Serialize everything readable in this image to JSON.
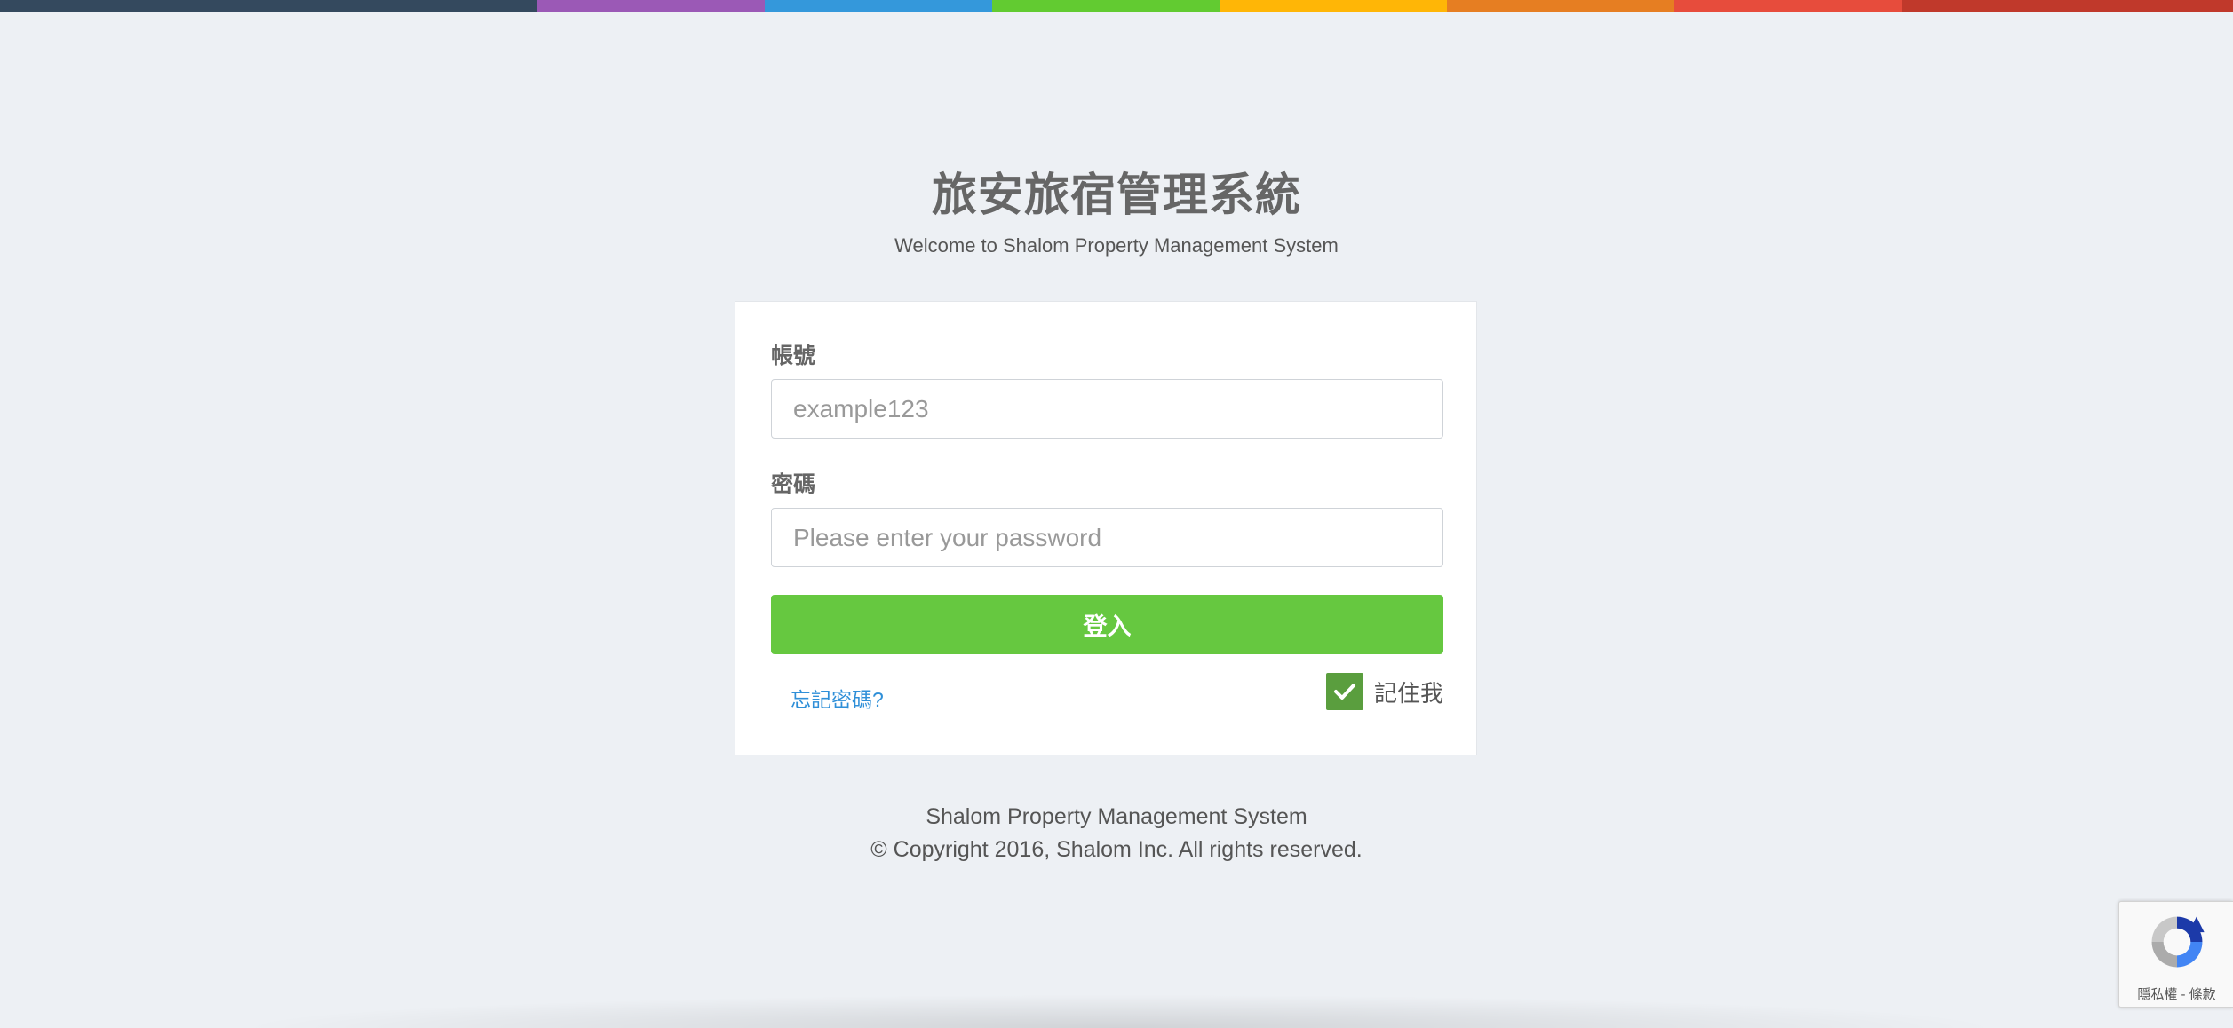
{
  "top_bar": {
    "colors": [
      "#34495e",
      "#9b59b6",
      "#3498db",
      "#62cb31",
      "#ffb606",
      "#e67e22",
      "#e74c3c",
      "#c0392b"
    ]
  },
  "header": {
    "title": "旅安旅宿管理系統",
    "subtitle": "Welcome to Shalom Property Management System"
  },
  "login_form": {
    "account_label": "帳號",
    "account_placeholder": "example123",
    "account_value": "",
    "password_label": "密碼",
    "password_placeholder": "Please enter your password",
    "password_value": "",
    "login_button_label": "登入",
    "forgot_password_label": "忘記密碼?",
    "remember_me_label": "記住我",
    "remember_me_checked": true
  },
  "footer": {
    "line1": "Shalom Property Management System",
    "line2": "© Copyright 2016, Shalom Inc. All rights reserved."
  },
  "recaptcha": {
    "links_text": "隱私權 - 條款"
  },
  "colors": {
    "background": "#edf0f4",
    "primary_green": "#66c840",
    "checkbox_green": "#5a9e3e",
    "link_blue": "#2f8fd8"
  }
}
